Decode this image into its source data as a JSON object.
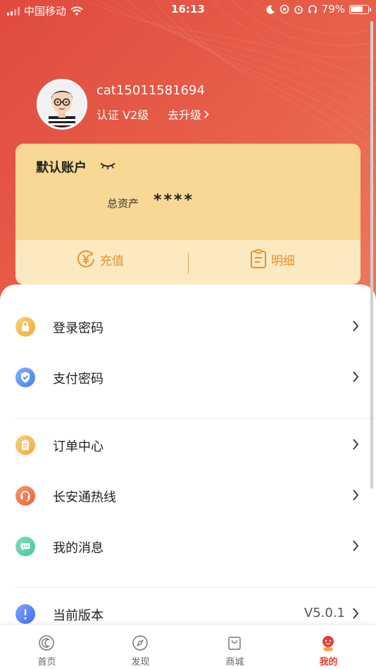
{
  "status_bar": {
    "carrier": "中国移动",
    "time": "16:13",
    "battery_percent": "79%",
    "battery_level": 0.79
  },
  "profile": {
    "username": "cat15011581694",
    "cert_level": "认证 V2级",
    "upgrade": "去升级"
  },
  "account_card": {
    "title": "默认账户",
    "assets_label": "总资产",
    "assets_value": "****",
    "recharge_label": "充值",
    "details_label": "明细"
  },
  "menu": {
    "login_password": "登录密码",
    "pay_password": "支付密码",
    "orders": "订单中心",
    "hotline": "长安通热线",
    "messages": "我的消息",
    "version_label": "当前版本",
    "version_value": "V5.0.1"
  },
  "tabs": [
    {
      "label": "首页",
      "icon": "home-icon"
    },
    {
      "label": "发现",
      "icon": "compass-icon"
    },
    {
      "label": "商城",
      "icon": "shopping-bag-icon"
    },
    {
      "label": "我的",
      "icon": "profile-icon"
    }
  ],
  "colors": {
    "header": "#e8604a",
    "card": "#f8d894",
    "accent_orange": "#e8902e",
    "active_tab": "#e2402f"
  }
}
